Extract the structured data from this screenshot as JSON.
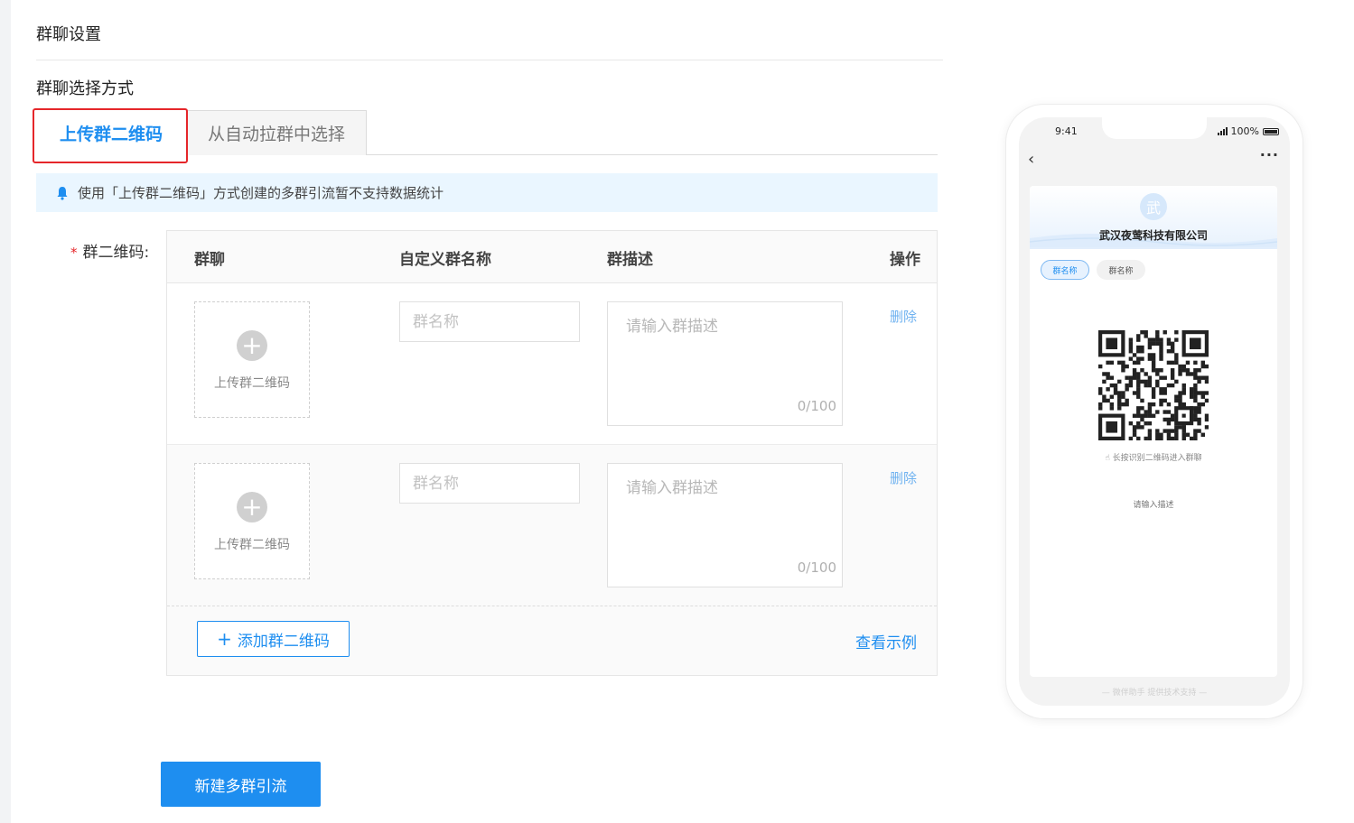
{
  "section_title": "群聊设置",
  "method_title": "群聊选择方式",
  "tabs": [
    {
      "label": "上传群二维码",
      "active": true
    },
    {
      "label": "从自动拉群中选择",
      "active": false
    }
  ],
  "notice": {
    "text": "使用「上传群二维码」方式创建的多群引流暂不支持数据统计",
    "icon": "bell-icon"
  },
  "form": {
    "required_mark": "*",
    "label": "群二维码:"
  },
  "table": {
    "headers": [
      "群聊",
      "自定义群名称",
      "群描述",
      "操作"
    ],
    "rows": [
      {
        "upload_label": "上传群二维码",
        "name_placeholder": "群名称",
        "desc_placeholder": "请输入群描述",
        "counter": "0/100",
        "delete_label": "删除"
      },
      {
        "upload_label": "上传群二维码",
        "name_placeholder": "群名称",
        "desc_placeholder": "请输入群描述",
        "counter": "0/100",
        "delete_label": "删除"
      }
    ],
    "add_label": "添加群二维码",
    "example_label": "查看示例"
  },
  "submit_label": "新建多群引流",
  "phone": {
    "time": "9:41",
    "battery": "100%",
    "avatar_char": "武",
    "company": "武汉夜莺科技有限公司",
    "chips": [
      {
        "label": "群名称",
        "selected": true
      },
      {
        "label": "群名称",
        "selected": false
      }
    ],
    "scan_hint": "长按识别二维码进入群聊",
    "desc_hint": "请输入描述",
    "footer": "— 微伴助手 提供技术支持 —"
  },
  "colors": {
    "primary": "#1e8ef0",
    "highlight": "#e5262a",
    "notice_bg": "#eaf6ff"
  }
}
